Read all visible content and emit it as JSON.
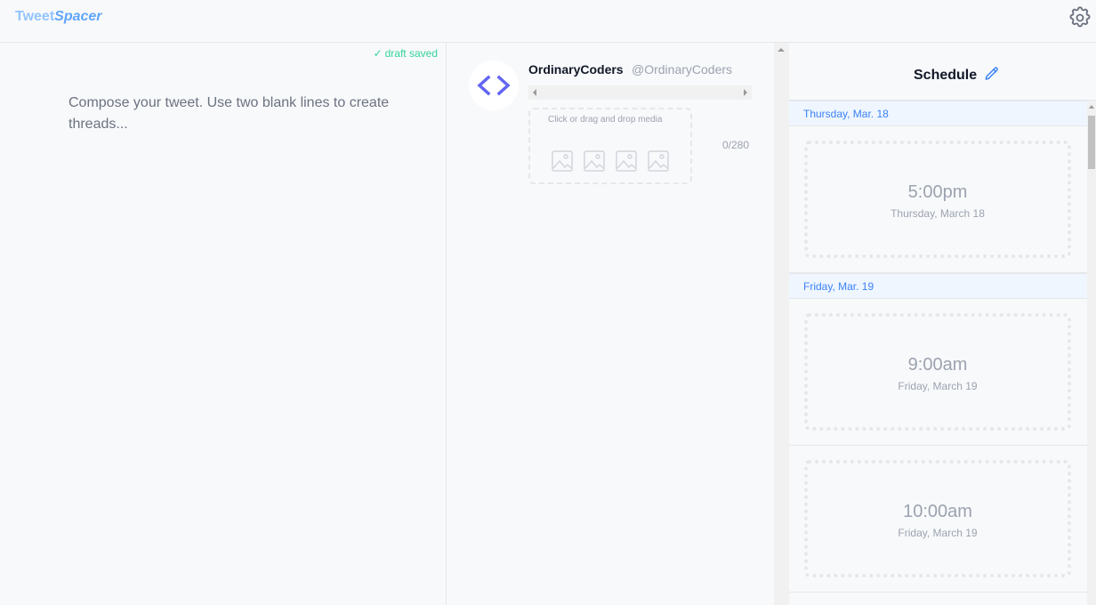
{
  "header": {
    "logo_first": "Tweet",
    "logo_second": "Spacer",
    "settings_icon": "gear-icon"
  },
  "compose": {
    "draft_status": "draft saved",
    "placeholder": "Compose your tweet. Use two blank lines to create threads..."
  },
  "preview": {
    "avatar_icon": "code-brackets-icon",
    "display_name": "OrdinaryCoders",
    "handle": "@OrdinaryCoders",
    "dropzone_text": "Click or drag and drop media",
    "char_count": "0/280"
  },
  "schedule": {
    "title": "Schedule",
    "edit_icon": "pencil-icon",
    "days": [
      {
        "label": "Thursday, Mar. 18",
        "slots": [
          {
            "time": "5:00pm",
            "date": "Thursday, March 18"
          }
        ]
      },
      {
        "label": "Friday, Mar. 19",
        "slots": [
          {
            "time": "9:00am",
            "date": "Friday, March 19"
          },
          {
            "time": "10:00am",
            "date": "Friday, March 19"
          }
        ]
      }
    ]
  },
  "colors": {
    "accent": "#3b82f6",
    "logo": "#60a5fa",
    "draft_saved": "#34d399",
    "avatar_icon": "#6366f1"
  }
}
